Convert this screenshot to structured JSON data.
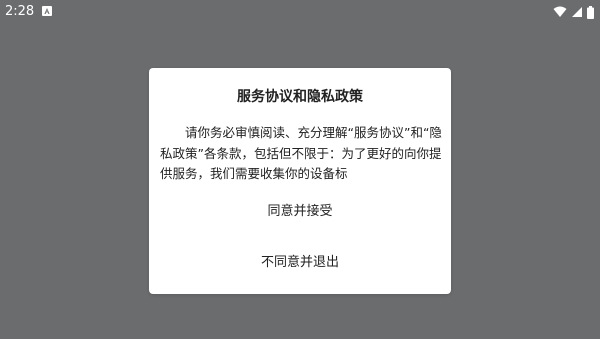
{
  "status_bar": {
    "time": "2:28",
    "icons": [
      "notification-a-icon",
      "wifi-icon",
      "signal-icon",
      "battery-icon"
    ]
  },
  "dialog": {
    "title": "服务协议和隐私政策",
    "body": "请你务必审慎阅读、充分理解“服务协议”和“隐私政策”各条款，包括但不限于：为了更好的向你提供服务，我们需要收集你的设备标",
    "agree_label": "同意并接受",
    "disagree_label": "不同意并退出"
  },
  "colors": {
    "scrim_background": "#6a6c6e",
    "dialog_background": "#ffffff",
    "text": "#222222"
  }
}
